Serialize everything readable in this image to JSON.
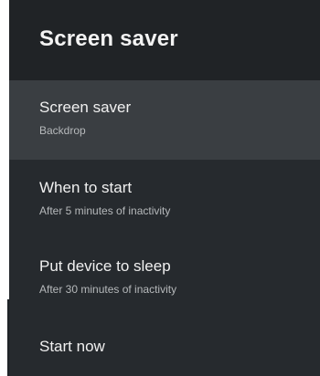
{
  "header": {
    "title": "Screen saver"
  },
  "menu": {
    "items": [
      {
        "title": "Screen saver",
        "summary": "Backdrop",
        "selected": true
      },
      {
        "title": "When to start",
        "summary": "After 5 minutes of inactivity",
        "selected": false
      },
      {
        "title": "Put device to sleep",
        "summary": "After 30 minutes of inactivity",
        "selected": false
      },
      {
        "title": "Start now",
        "selected": false
      }
    ]
  },
  "colors": {
    "panel_background": "#262a2e",
    "header_background": "#202326",
    "selected_background": "#3a3e42",
    "title_text": "#f0f0f0",
    "summary_text": "#b6b9bb"
  }
}
